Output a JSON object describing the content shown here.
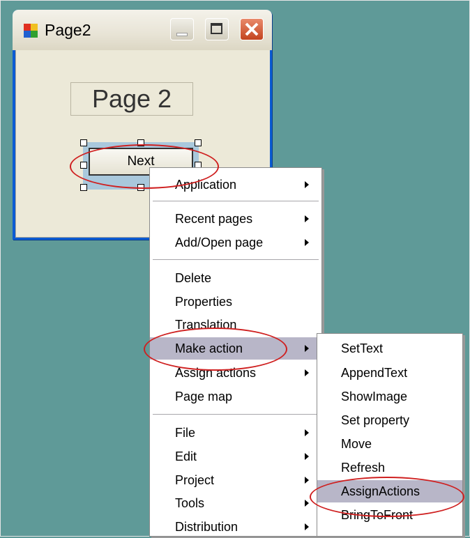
{
  "window": {
    "title": "Page2",
    "page_label": "Page 2",
    "button_label": "Next"
  },
  "context_menu": {
    "groups": [
      [
        {
          "label": "Application",
          "submenu": true
        }
      ],
      [
        {
          "label": "Recent pages",
          "submenu": true
        },
        {
          "label": "Add/Open page",
          "submenu": true
        }
      ],
      [
        {
          "label": "Delete"
        },
        {
          "label": "Properties"
        },
        {
          "label": "Translation"
        },
        {
          "label": "Make action",
          "submenu": true,
          "highlighted": true
        },
        {
          "label": "Assign actions",
          "submenu": true
        },
        {
          "label": "Page map"
        }
      ],
      [
        {
          "label": "File",
          "submenu": true
        },
        {
          "label": "Edit",
          "submenu": true
        },
        {
          "label": "Project",
          "submenu": true
        },
        {
          "label": "Tools",
          "submenu": true
        },
        {
          "label": "Distribution",
          "submenu": true
        }
      ]
    ]
  },
  "submenu": {
    "items": [
      {
        "label": "SetText"
      },
      {
        "label": "AppendText"
      },
      {
        "label": "ShowImage"
      },
      {
        "label": "Set property"
      },
      {
        "label": "Move"
      },
      {
        "label": "Refresh"
      },
      {
        "label": "AssignActions",
        "highlighted": true
      },
      {
        "label": "BringToFront"
      }
    ]
  },
  "colors": {
    "desktop": "#5f9a98",
    "highlight": "#b8b6c8",
    "annotation": "#cf2020"
  }
}
